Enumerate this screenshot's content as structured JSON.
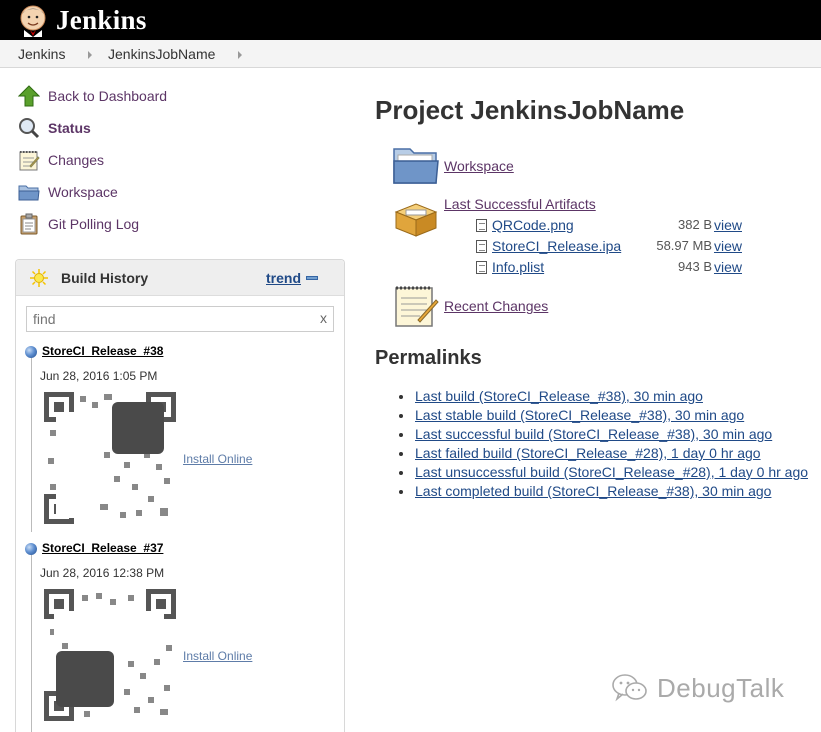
{
  "header": {
    "brand": "Jenkins"
  },
  "breadcrumbs": [
    {
      "label": "Jenkins"
    },
    {
      "label": "JenkinsJobName"
    }
  ],
  "sidebar": {
    "tasks": [
      {
        "label": "Back to Dashboard",
        "icon": "up-arrow-icon"
      },
      {
        "label": "Status",
        "icon": "magnifier-icon"
      },
      {
        "label": "Changes",
        "icon": "notepad-icon"
      },
      {
        "label": "Workspace",
        "icon": "folder-icon"
      },
      {
        "label": "Git Polling Log",
        "icon": "clipboard-icon"
      }
    ]
  },
  "build_history": {
    "title": "Build History",
    "trend_label": "trend",
    "search_placeholder": "find",
    "clear_label": "x",
    "install_label": "Install Online",
    "builds": [
      {
        "name": "StoreCI_Release_#38",
        "date": "Jun 28, 2016 1:05 PM"
      },
      {
        "name": "StoreCI_Release_#37",
        "date": "Jun 28, 2016 12:38 PM"
      }
    ]
  },
  "main": {
    "title": "Project JenkinsJobName",
    "workspace_label": "Workspace",
    "artifacts_label": "Last Successful Artifacts",
    "artifacts": [
      {
        "name": "QRCode.png",
        "size": "382 B",
        "view": "view"
      },
      {
        "name": "StoreCI_Release.ipa",
        "size": "58.97 MB",
        "view": "view"
      },
      {
        "name": "Info.plist",
        "size": "943 B",
        "view": "view"
      }
    ],
    "recent_changes_label": "Recent Changes",
    "permalinks_title": "Permalinks",
    "permalinks": [
      "Last build (StoreCI_Release_#38), 30 min ago",
      "Last stable build (StoreCI_Release_#38), 30 min ago",
      "Last successful build (StoreCI_Release_#38), 30 min ago",
      "Last failed build (StoreCI_Release_#28), 1 day 0 hr ago",
      "Last unsuccessful build (StoreCI_Release_#28), 1 day 0 hr ago",
      "Last completed build (StoreCI_Release_#38), 30 min ago"
    ]
  },
  "watermark": {
    "text": "DebugTalk"
  },
  "colors": {
    "header_bg": "#000000",
    "link": "#204a87",
    "visited_link": "#5c3566"
  }
}
